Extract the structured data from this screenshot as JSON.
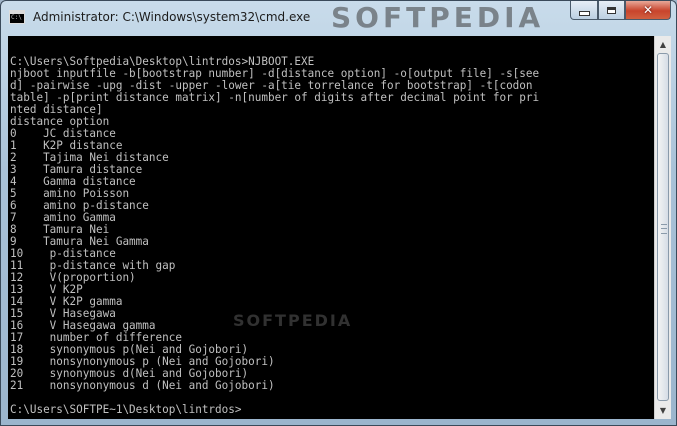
{
  "window": {
    "title": "Administrator: C:\\Windows\\system32\\cmd.exe",
    "watermark_top": "SOFTPEDIA",
    "watermark_mid": "SOFTPEDIA"
  },
  "controls": {
    "close_glyph": "✕",
    "scroll_up_glyph": "▲",
    "scroll_down_glyph": "▼"
  },
  "console": {
    "lines": [
      "",
      "C:\\Users\\Softpedia\\Desktop\\lintrdos>NJBOOT.EXE",
      "njboot inputfile -b[bootstrap number] -d[distance option] -o[output file] -s[see",
      "d] -pairwise -upg -dist -upper -lower -a[tie torrelance for bootstrap] -t[codon",
      "table] -p[print distance matrix] -n[number of digits after decimal point for pri",
      "nted distance]",
      "distance option",
      "0    JC distance",
      "1    K2P distance",
      "2    Tajima Nei distance",
      "3    Tamura distance",
      "4    Gamma distance",
      "5    amino Poisson",
      "6    amino p-distance",
      "7    amino Gamma",
      "8    Tamura Nei",
      "9    Tamura Nei Gamma",
      "10    p-distance",
      "11    p-distance with gap",
      "12    V(proportion)",
      "13    V K2P",
      "14    V K2P gamma",
      "15    V Hasegawa",
      "16    V Hasegawa gamma",
      "17    number of difference",
      "18    synonymous p(Nei and Gojobori)",
      "19    nonsynonymous p (Nei and Gojobori)",
      "20    synonymous d(Nei and Gojobori)",
      "21    nonsynonymous d (Nei and Gojobori)",
      "",
      "C:\\Users\\SOFTPE~1\\Desktop\\lintrdos>"
    ]
  }
}
